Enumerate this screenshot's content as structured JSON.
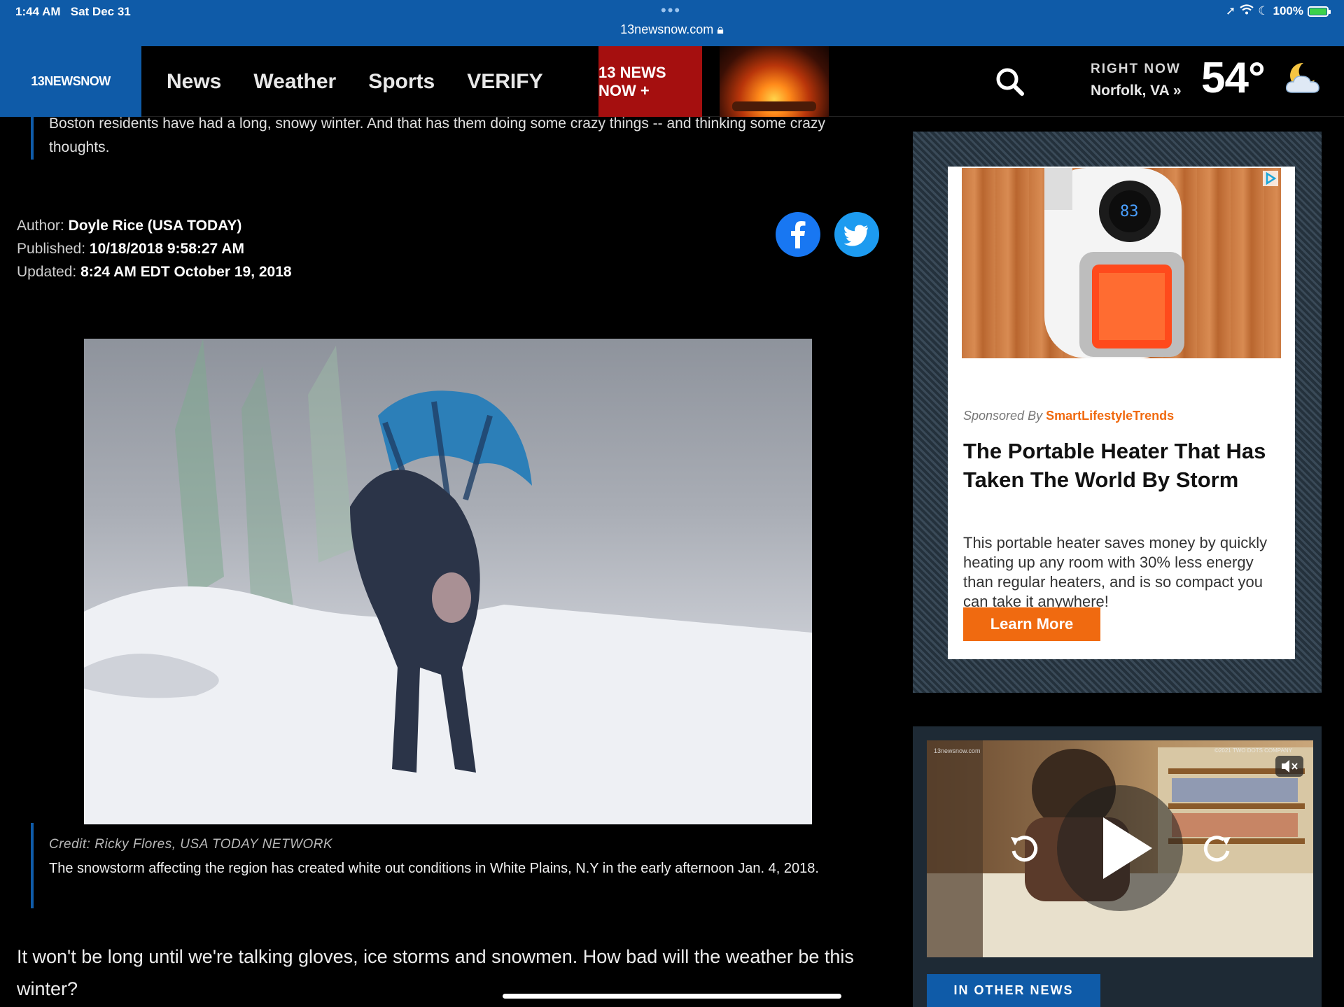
{
  "status_bar": {
    "time": "1:44 AM",
    "date": "Sat Dec 31",
    "url": "13newsnow.com",
    "battery": "100%"
  },
  "nav": {
    "logo": "13NEWSNOW",
    "links": [
      "News",
      "Weather",
      "Sports",
      "VERIFY"
    ],
    "plus_badge": "13 NEWS NOW +",
    "right_now_label": "RIGHT NOW",
    "location": "Norfolk, VA »",
    "temperature": "54°"
  },
  "article": {
    "subhead": "Boston residents have had a long, snowy winter. And that has them doing some crazy things -- and thinking some crazy thoughts.",
    "author_label": "Author:",
    "author": "Doyle Rice (USA TODAY)",
    "published_label": "Published:",
    "published": "10/18/2018 9:58:27 AM",
    "updated_label": "Updated:",
    "updated": "8:24 AM EDT October 19, 2018",
    "photo_credit": "Credit: Ricky Flores, USA TODAY NETWORK",
    "photo_caption": "The snowstorm affecting the region has created white out conditions in White Plains, N.Y in the early afternoon Jan. 4, 2018.",
    "body": "It won't be long until we're talking gloves, ice storms and snowmen. How bad will the weather be this winter?"
  },
  "ad": {
    "heater_display": "83",
    "sponsored_by": "Sponsored By",
    "sponsor": "SmartLifestyleTrends",
    "title": "The Portable Heater That Has Taken The World By Storm",
    "description": "This portable heater saves money by quickly heating up any room with 30% less energy than regular heaters, and is so compact you can take it anywhere!",
    "button": "Learn More"
  },
  "video": {
    "watermark_left": "13newsnow.com",
    "watermark_right": "©2021 TWO DOTS COMPANY",
    "section_label": "IN OTHER NEWS"
  },
  "colors": {
    "brand_blue": "#0f5ba8",
    "plus_red": "#a50f0f",
    "ad_orange": "#f06a10"
  }
}
